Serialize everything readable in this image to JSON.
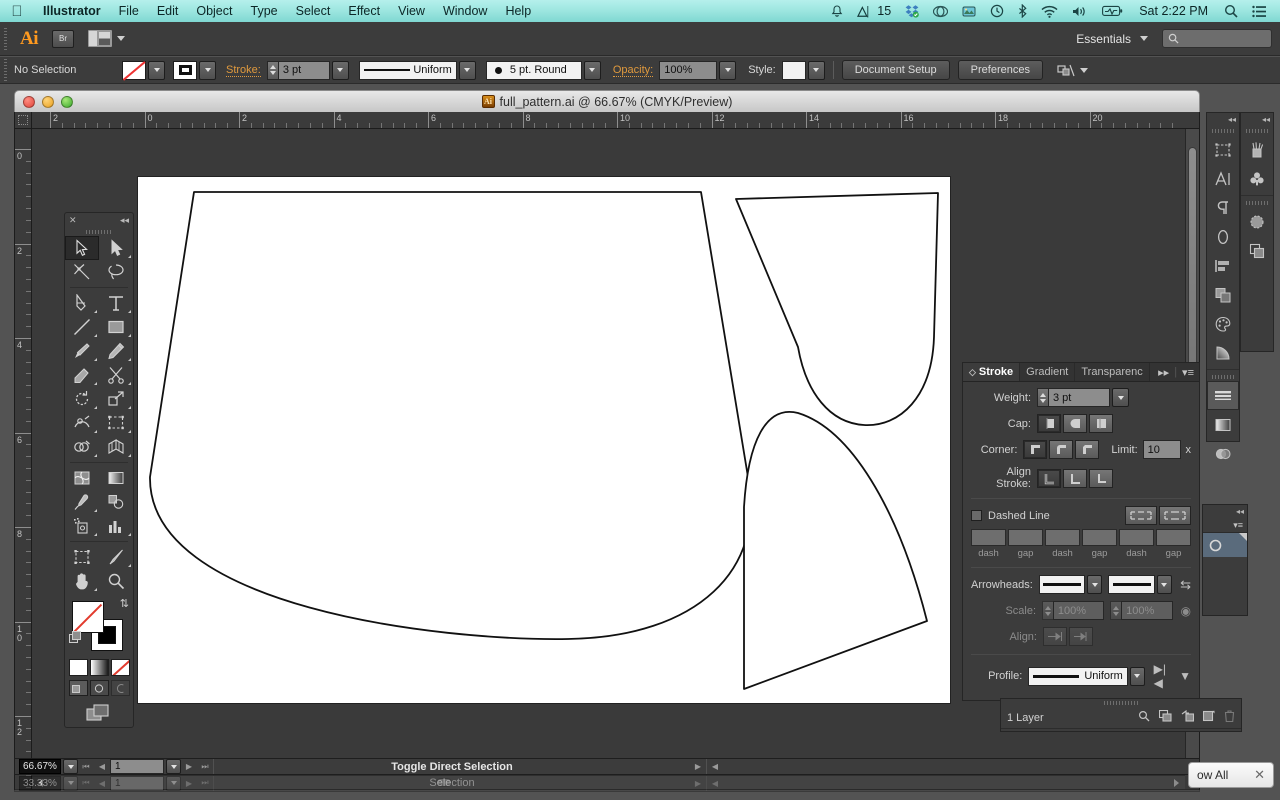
{
  "macmenu": {
    "apple": "apple-logo",
    "items": [
      "Illustrator",
      "File",
      "Edit",
      "Object",
      "Type",
      "Select",
      "Effect",
      "View",
      "Window",
      "Help"
    ],
    "status_icons": [
      "notification-bell-icon",
      "adobe-app-icon",
      "dropbox-icon",
      "creative-cloud-icon",
      "utility-icon",
      "time-machine-icon",
      "bluetooth-icon",
      "wifi-icon",
      "volume-icon",
      "battery-icon"
    ],
    "adobe_count": "15",
    "clock": "Sat 2:22 PM",
    "spotlight": "search-icon",
    "notification_center": "list-icon"
  },
  "brandbar": {
    "logo": "Ai",
    "bridge_label": "Br",
    "arrange_icon": "arrange-documents-icon",
    "workspace": "Essentials",
    "search_placeholder": ""
  },
  "controlbar": {
    "selection_status": "No Selection",
    "fill_label": "fill-swatch-none",
    "stroke_label": "stroke-swatch",
    "stroke_text": "Stroke:",
    "stroke_weight": "3 pt",
    "profile_value": "Uniform",
    "brush_value": "5 pt. Round",
    "opacity_label": "Opacity:",
    "opacity_value": "100%",
    "style_label": "Style:",
    "document_setup": "Document Setup",
    "preferences": "Preferences",
    "align_icon": "align-objects-icon"
  },
  "document": {
    "title": "full_pattern.ai @ 66.67% (CMYK/Preview)",
    "traffic": [
      "close-button",
      "minimize-button",
      "zoom-button"
    ],
    "ruler_h": [
      "2",
      "0",
      "2",
      "4",
      "6",
      "8",
      "10",
      "12",
      "14",
      "16",
      "18",
      "20"
    ],
    "ruler_v": [
      "0",
      "2",
      "4",
      "6",
      "8",
      "10",
      "12"
    ],
    "ruler_unit": "inches"
  },
  "tools": {
    "close_icon": "close-icon",
    "collapse_icon": "collapse-icon",
    "items": [
      {
        "name": "selection-tool",
        "selected": true
      },
      {
        "name": "direct-selection-tool",
        "selected": false
      },
      {
        "name": "magic-wand-tool",
        "selected": false
      },
      {
        "name": "lasso-tool",
        "selected": false
      },
      {
        "name": "pen-tool",
        "selected": false
      },
      {
        "name": "type-tool",
        "selected": false
      },
      {
        "name": "line-segment-tool",
        "selected": false
      },
      {
        "name": "rectangle-tool",
        "selected": false
      },
      {
        "name": "paintbrush-tool",
        "selected": false
      },
      {
        "name": "pencil-tool",
        "selected": false
      },
      {
        "name": "blob-brush-tool",
        "selected": false
      },
      {
        "name": "scissors-tool",
        "selected": false
      },
      {
        "name": "rotate-tool",
        "selected": false
      },
      {
        "name": "scale-tool",
        "selected": false
      },
      {
        "name": "width-tool",
        "selected": false
      },
      {
        "name": "free-transform-tool",
        "selected": false
      },
      {
        "name": "shape-builder-tool",
        "selected": false
      },
      {
        "name": "perspective-grid-tool",
        "selected": false
      },
      {
        "name": "mesh-tool",
        "selected": false
      },
      {
        "name": "gradient-tool",
        "selected": false
      },
      {
        "name": "eyedropper-tool",
        "selected": false
      },
      {
        "name": "blend-tool",
        "selected": false
      },
      {
        "name": "symbol-sprayer-tool",
        "selected": false
      },
      {
        "name": "column-graph-tool",
        "selected": false
      },
      {
        "name": "artboard-tool",
        "selected": false
      },
      {
        "name": "slice-tool",
        "selected": false
      },
      {
        "name": "hand-tool",
        "selected": false
      },
      {
        "name": "zoom-tool",
        "selected": false
      }
    ],
    "fill_stroke": {
      "fill": "none-fill-proxy",
      "stroke": "black-stroke-proxy",
      "swap_icon": "swap-fill-stroke-icon",
      "default_icon": "default-fill-stroke-icon"
    },
    "color_modes": [
      "color-mode-button",
      "gradient-mode-button",
      "none-mode-button"
    ],
    "draw_modes": [
      "draw-normal-button",
      "draw-behind-button",
      "draw-inside-button"
    ],
    "screen_mode": "change-screen-mode-button"
  },
  "stroke_panel": {
    "tabs": [
      {
        "label": "Stroke",
        "active": true
      },
      {
        "label": "Gradient",
        "active": false
      },
      {
        "label": "Transparenc",
        "active": false
      }
    ],
    "expand_icon": "expand-panels-icon",
    "menu_icon": "panel-menu-icon",
    "weight_label": "Weight:",
    "weight_value": "3 pt",
    "cap_label": "Cap:",
    "cap_options": [
      "butt-cap",
      "round-cap",
      "projecting-cap"
    ],
    "cap_selected": 0,
    "corner_label": "Corner:",
    "corner_options": [
      "miter-join",
      "round-join",
      "bevel-join"
    ],
    "corner_selected": 0,
    "limit_label": "Limit:",
    "limit_value": "10",
    "limit_unit": "x",
    "align_label": "Align Stroke:",
    "align_options": [
      "align-center-stroke",
      "align-inside-stroke",
      "align-outside-stroke"
    ],
    "align_selected": 0,
    "dashed_label": "Dashed Line",
    "dashed_checked": false,
    "dash_corner_options": [
      "dashes-preserve-exact",
      "dashes-adjust-to-fit"
    ],
    "dash_fields": [
      "dash",
      "gap",
      "dash",
      "gap",
      "dash",
      "gap"
    ],
    "arrowheads_label": "Arrowheads:",
    "arrow_swap_icon": "swap-arrowheads-icon",
    "scale_label": "Scale:",
    "scale_start": "100%",
    "scale_end": "100%",
    "scale_link_icon": "link-scale-icon",
    "align_arrow_label": "Align:",
    "align_arrow_options": [
      "extend-arrow-beyond-end",
      "place-arrow-at-end"
    ],
    "profile_label": "Profile:",
    "profile_value": "Uniform",
    "flip_across_icon": "flip-across-icon",
    "flip_along_icon": "flip-along-icon"
  },
  "layers_panel": {
    "count_label": "1 Layer",
    "icons": [
      "locate-object-icon",
      "make-mask-icon",
      "create-sublayer-icon",
      "new-layer-icon",
      "delete-layer-icon"
    ]
  },
  "right_dock": {
    "column_a": [
      "artboards-icon",
      "character-icon",
      "paragraph-icon",
      "glyphs-icon",
      "align-icon",
      "pathfinder-icon",
      "color-guide-icon",
      "gradient-icon",
      "stroke-icon",
      "gradient-panel-icon",
      "transparency-icon"
    ],
    "column_b": [
      "brushes-icon",
      "symbols-icon",
      "appearance-icon",
      "graphic-styles-icon"
    ],
    "collapse_icon": "collapse-to-icons-icon"
  },
  "mini_panel": {
    "collapse_icon": "collapse-icon",
    "menu_icon": "panel-menu-icon",
    "row_icon": "symbol-thumbnail"
  },
  "statusbar": {
    "zoom": "66.67%",
    "page": "1",
    "status_text": "Toggle Direct Selection",
    "ghost_zoom": "33.33%",
    "ghost_page": "1",
    "ghost_status": "Selection",
    "nav_icons": [
      "first-page-icon",
      "prev-page-icon",
      "next-page-icon",
      "last-page-icon"
    ]
  },
  "show_all": {
    "label": "ow All",
    "close_icon": "close-icon"
  },
  "artwork": {
    "description": "three black-outlined pattern piece vector shapes on white artboard",
    "shapes": [
      "pattern-piece-large-left",
      "pattern-piece-top-right",
      "pattern-piece-bottom-right"
    ]
  },
  "colors": {
    "menubar_accent": "#9de6e0",
    "panel_bg": "#3c3c3c",
    "canvas_bg": "#3a3a3a",
    "artboard": "#ffffff",
    "orange_label": "#e09a3e",
    "ai_logo": "#ff9a1f"
  }
}
